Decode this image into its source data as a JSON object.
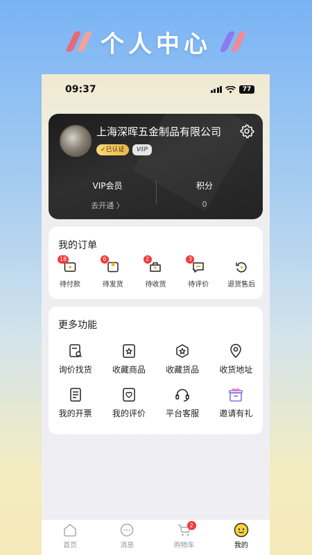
{
  "banner": {
    "title": "个人中心"
  },
  "status_bar": {
    "time": "09:37",
    "battery": "77"
  },
  "profile": {
    "company_name": "上海深晖五金制品有限公司",
    "certified_label": "已认证",
    "vip_badge": "VIP"
  },
  "vip_stats": {
    "vip_label": "VIP会员",
    "vip_action": "去开通 〉",
    "points_label": "积分",
    "points_value": "0"
  },
  "orders": {
    "title": "我的订单",
    "items": [
      {
        "label": "待付款",
        "count": "18",
        "icon": "wallet-icon"
      },
      {
        "label": "待发货",
        "count": "6",
        "icon": "package-icon"
      },
      {
        "label": "待收货",
        "count": "2",
        "icon": "receive-box-icon"
      },
      {
        "label": "待评价",
        "count": "3",
        "icon": "comment-icon"
      },
      {
        "label": "退货售后",
        "count": "",
        "icon": "return-icon"
      }
    ]
  },
  "more_functions": {
    "title": "更多功能",
    "items": [
      {
        "label": "询价找货",
        "icon": "inquiry-icon"
      },
      {
        "label": "收藏商品",
        "icon": "favorite-product-icon"
      },
      {
        "label": "收藏货品",
        "icon": "favorite-goods-icon"
      },
      {
        "label": "收货地址",
        "icon": "location-icon"
      },
      {
        "label": "我的开票",
        "icon": "invoice-icon"
      },
      {
        "label": "我的评价",
        "icon": "review-icon"
      },
      {
        "label": "平台客服",
        "icon": "headset-icon"
      },
      {
        "label": "邀请有礼",
        "icon": "gift-icon"
      }
    ]
  },
  "tabbar": {
    "items": [
      {
        "label": "首页",
        "icon": "home-icon"
      },
      {
        "label": "消息",
        "icon": "message-icon"
      },
      {
        "label": "购物车",
        "icon": "cart-icon",
        "count": "2"
      },
      {
        "label": "我的",
        "icon": "smiley-icon",
        "active": true
      }
    ]
  },
  "colors": {
    "accent_red": "#f23b3b",
    "card_dark": "#232323",
    "cert_gold": "#e9b94a",
    "gift_purple": "#8a6be8"
  }
}
